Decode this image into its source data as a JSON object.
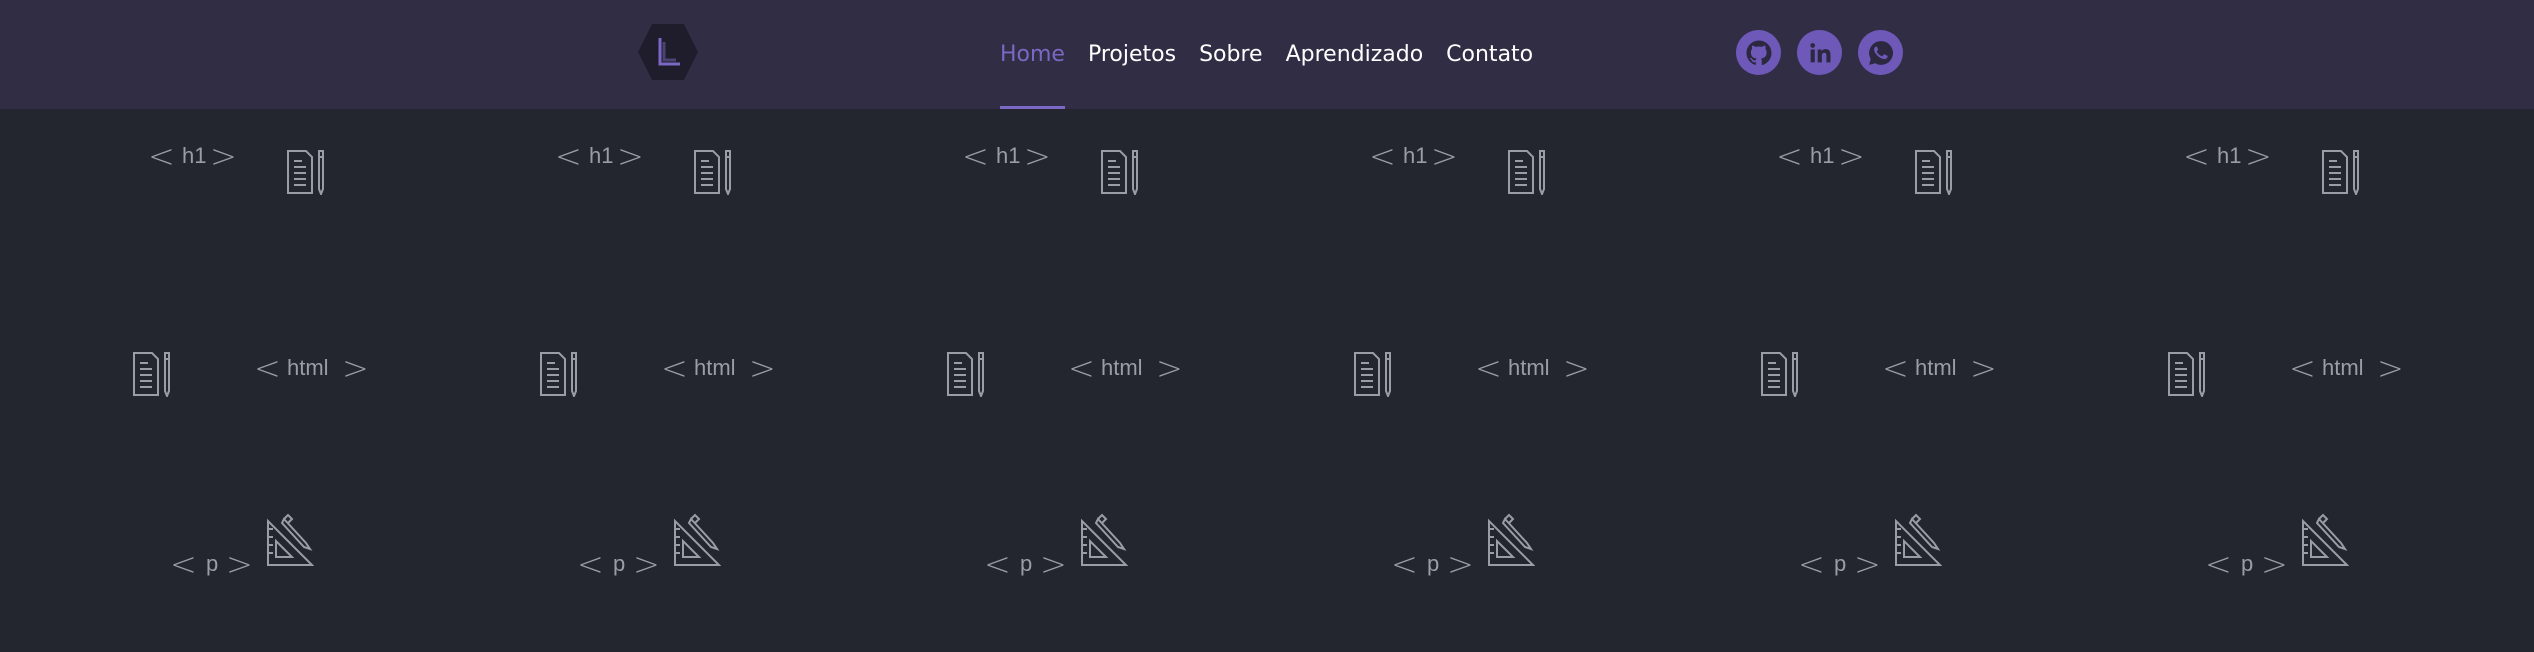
{
  "nav": {
    "links": [
      {
        "label": "Home",
        "active": true
      },
      {
        "label": "Projetos",
        "active": false
      },
      {
        "label": "Sobre",
        "active": false
      },
      {
        "label": "Aprendizado",
        "active": false
      },
      {
        "label": "Contato",
        "active": false
      }
    ]
  },
  "social": [
    {
      "icon": "github-icon"
    },
    {
      "icon": "linkedin-icon"
    },
    {
      "icon": "whatsapp-icon"
    }
  ],
  "pattern": {
    "tags": {
      "h1": "h1",
      "html": "html",
      "p": "p"
    }
  },
  "colors": {
    "navbar": "#302d44",
    "background": "#23252f",
    "accent": "#7b68c4",
    "pattern": "#9a9ca6"
  }
}
